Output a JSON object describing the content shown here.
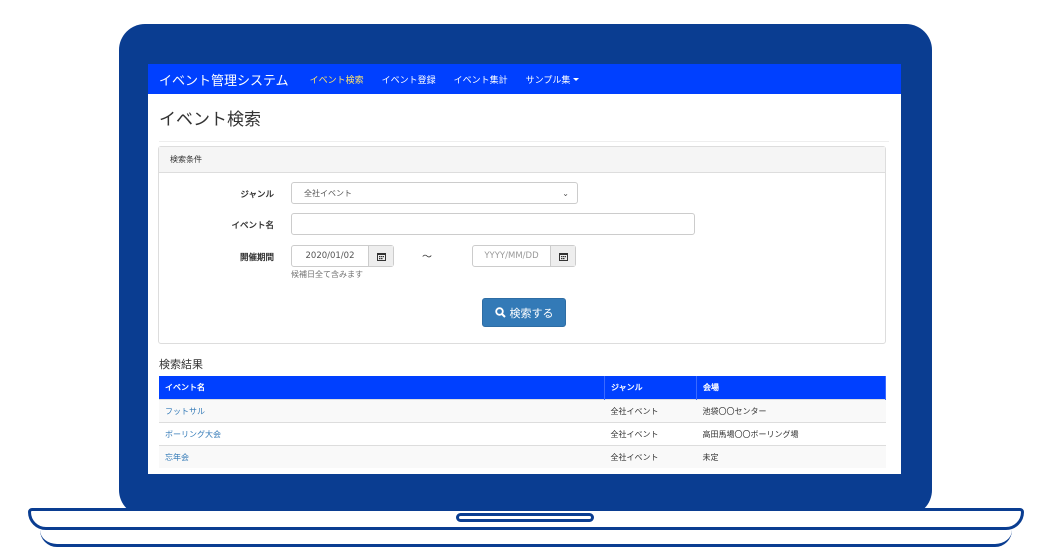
{
  "navbar": {
    "brand": "イベント管理システム",
    "items": [
      {
        "label": "イベント検索",
        "active": true
      },
      {
        "label": "イベント登録",
        "active": false
      },
      {
        "label": "イベント集計",
        "active": false
      },
      {
        "label": "サンプル集",
        "active": false,
        "dropdown": true
      }
    ]
  },
  "page": {
    "title": "イベント検索"
  },
  "search_panel": {
    "heading": "検索条件",
    "genre_label": "ジャンル",
    "genre_selected": "全社イベント",
    "event_name_label": "イベント名",
    "event_name_value": "",
    "period_label": "開催期間",
    "date_from": "2020/01/02",
    "tilde": "～",
    "date_to_placeholder": "YYYY/MM/DD",
    "help_text": "候補日全て含みます",
    "search_button": "検索する"
  },
  "results": {
    "title": "検索結果",
    "headers": [
      "イベント名",
      "ジャンル",
      "会場"
    ],
    "rows": [
      [
        "フットサル",
        "全社イベント",
        "池袋〇〇センター"
      ],
      [
        "ボーリング大会",
        "全社イベント",
        "高田馬場〇〇ボーリング場"
      ],
      [
        "忘年会",
        "全社イベント",
        "未定"
      ]
    ]
  },
  "colors": {
    "frame": "#0a3d91",
    "navbar": "#0040ff",
    "nav_active_text": "#ffe36a",
    "button": "#337ab7",
    "link": "#337ab7"
  }
}
